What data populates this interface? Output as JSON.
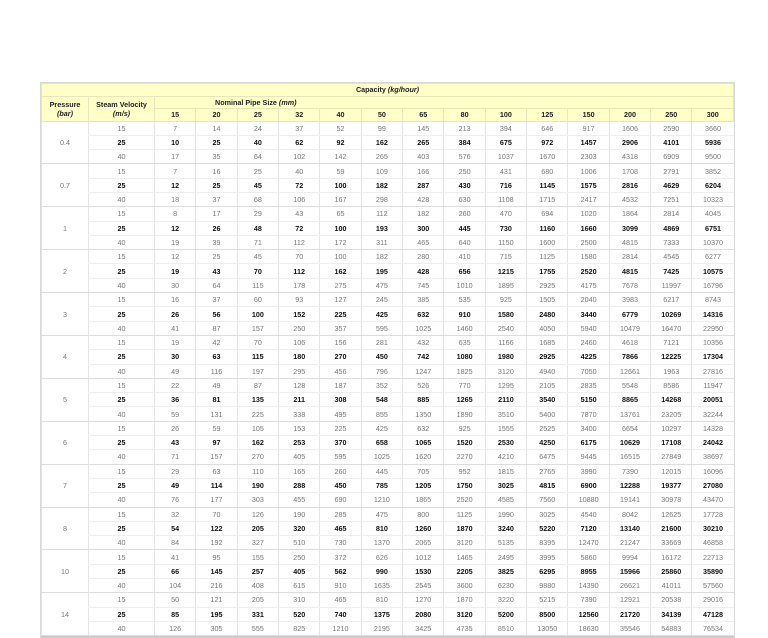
{
  "header": {
    "capacity": "Capacity",
    "capacity_unit": "(kg/hour)",
    "pressure": "Pressure",
    "pressure_unit": "(bar)",
    "velocity": "Steam Velocity",
    "velocity_unit": "(m/s)",
    "nominal": "Nominal Pipe Size",
    "nominal_unit": "(mm)"
  },
  "sizes": [
    "15",
    "20",
    "25",
    "32",
    "40",
    "50",
    "65",
    "80",
    "100",
    "125",
    "150",
    "200",
    "250",
    "300"
  ],
  "groups": [
    {
      "pressure": "0.4",
      "rows": [
        {
          "v": "15",
          "c": [
            "7",
            "14",
            "24",
            "37",
            "52",
            "99",
            "145",
            "213",
            "394",
            "646",
            "917",
            "1606",
            "2590",
            "3660"
          ]
        },
        {
          "v": "25",
          "c": [
            "10",
            "25",
            "40",
            "62",
            "92",
            "162",
            "265",
            "384",
            "675",
            "972",
            "1457",
            "2906",
            "4101",
            "5936"
          ]
        },
        {
          "v": "40",
          "c": [
            "17",
            "35",
            "64",
            "102",
            "142",
            "265",
            "403",
            "576",
            "1037",
            "1670",
            "2303",
            "4318",
            "6909",
            "9500"
          ]
        }
      ]
    },
    {
      "pressure": "0.7",
      "rows": [
        {
          "v": "15",
          "c": [
            "7",
            "16",
            "25",
            "40",
            "59",
            "109",
            "166",
            "250",
            "431",
            "680",
            "1006",
            "1708",
            "2791",
            "3852"
          ]
        },
        {
          "v": "25",
          "c": [
            "12",
            "25",
            "45",
            "72",
            "100",
            "182",
            "287",
            "430",
            "716",
            "1145",
            "1575",
            "2816",
            "4629",
            "6204"
          ]
        },
        {
          "v": "40",
          "c": [
            "18",
            "37",
            "68",
            "106",
            "167",
            "298",
            "428",
            "630",
            "1108",
            "1715",
            "2417",
            "4532",
            "7251",
            "10323"
          ]
        }
      ]
    },
    {
      "pressure": "1",
      "rows": [
        {
          "v": "15",
          "c": [
            "8",
            "17",
            "29",
            "43",
            "65",
            "112",
            "182",
            "260",
            "470",
            "694",
            "1020",
            "1864",
            "2814",
            "4045"
          ]
        },
        {
          "v": "25",
          "c": [
            "12",
            "26",
            "48",
            "72",
            "100",
            "193",
            "300",
            "445",
            "730",
            "1160",
            "1660",
            "3099",
            "4869",
            "6751"
          ]
        },
        {
          "v": "40",
          "c": [
            "19",
            "39",
            "71",
            "112",
            "172",
            "311",
            "465",
            "640",
            "1150",
            "1600",
            "2500",
            "4815",
            "7333",
            "10370"
          ]
        }
      ]
    },
    {
      "pressure": "2",
      "rows": [
        {
          "v": "15",
          "c": [
            "12",
            "25",
            "45",
            "70",
            "100",
            "182",
            "280",
            "410",
            "715",
            "1125",
            "1580",
            "2814",
            "4545",
            "6277"
          ]
        },
        {
          "v": "25",
          "c": [
            "19",
            "43",
            "70",
            "112",
            "162",
            "195",
            "428",
            "656",
            "1215",
            "1755",
            "2520",
            "4815",
            "7425",
            "10575"
          ]
        },
        {
          "v": "40",
          "c": [
            "30",
            "64",
            "115",
            "178",
            "275",
            "475",
            "745",
            "1010",
            "1895",
            "2925",
            "4175",
            "7678",
            "11997",
            "16796"
          ]
        }
      ]
    },
    {
      "pressure": "3",
      "rows": [
        {
          "v": "15",
          "c": [
            "16",
            "37",
            "60",
            "93",
            "127",
            "245",
            "385",
            "535",
            "925",
            "1505",
            "2040",
            "3983",
            "6217",
            "8743"
          ]
        },
        {
          "v": "25",
          "c": [
            "26",
            "56",
            "100",
            "152",
            "225",
            "425",
            "632",
            "910",
            "1580",
            "2480",
            "3440",
            "6779",
            "10269",
            "14316"
          ]
        },
        {
          "v": "40",
          "c": [
            "41",
            "87",
            "157",
            "250",
            "357",
            "595",
            "1025",
            "1460",
            "2540",
            "4050",
            "5940",
            "10479",
            "16470",
            "22950"
          ]
        }
      ]
    },
    {
      "pressure": "4",
      "rows": [
        {
          "v": "15",
          "c": [
            "19",
            "42",
            "70",
            "106",
            "156",
            "281",
            "432",
            "635",
            "1166",
            "1685",
            "2460",
            "4618",
            "7121",
            "10356"
          ]
        },
        {
          "v": "25",
          "c": [
            "30",
            "63",
            "115",
            "180",
            "270",
            "450",
            "742",
            "1080",
            "1980",
            "2925",
            "4225",
            "7866",
            "12225",
            "17304"
          ]
        },
        {
          "v": "40",
          "c": [
            "49",
            "116",
            "197",
            "295",
            "456",
            "796",
            "1247",
            "1825",
            "3120",
            "4940",
            "7050",
            "12661",
            "1963",
            "27816"
          ]
        }
      ]
    },
    {
      "pressure": "5",
      "rows": [
        {
          "v": "15",
          "c": [
            "22",
            "49",
            "87",
            "128",
            "187",
            "352",
            "526",
            "770",
            "1295",
            "2105",
            "2835",
            "5548",
            "8586",
            "11947"
          ]
        },
        {
          "v": "25",
          "c": [
            "36",
            "81",
            "135",
            "211",
            "308",
            "548",
            "885",
            "1265",
            "2110",
            "3540",
            "5150",
            "8865",
            "14268",
            "20051"
          ]
        },
        {
          "v": "40",
          "c": [
            "59",
            "131",
            "225",
            "338",
            "495",
            "855",
            "1350",
            "1890",
            "3510",
            "5400",
            "7870",
            "13761",
            "23205",
            "32244"
          ]
        }
      ]
    },
    {
      "pressure": "6",
      "rows": [
        {
          "v": "15",
          "c": [
            "26",
            "59",
            "105",
            "153",
            "225",
            "425",
            "632",
            "925",
            "1555",
            "2525",
            "3400",
            "6654",
            "10297",
            "14328"
          ]
        },
        {
          "v": "25",
          "c": [
            "43",
            "97",
            "162",
            "253",
            "370",
            "658",
            "1065",
            "1520",
            "2530",
            "4250",
            "6175",
            "10629",
            "17108",
            "24042"
          ]
        },
        {
          "v": "40",
          "c": [
            "71",
            "157",
            "270",
            "405",
            "595",
            "1025",
            "1620",
            "2270",
            "4210",
            "6475",
            "9445",
            "16515",
            "27849",
            "38697"
          ]
        }
      ]
    },
    {
      "pressure": "7",
      "rows": [
        {
          "v": "15",
          "c": [
            "29",
            "63",
            "110",
            "165",
            "260",
            "445",
            "705",
            "952",
            "1815",
            "2765",
            "3990",
            "7390",
            "12015",
            "16096"
          ]
        },
        {
          "v": "25",
          "c": [
            "49",
            "114",
            "190",
            "288",
            "450",
            "785",
            "1205",
            "1750",
            "3025",
            "4815",
            "6900",
            "12288",
            "19377",
            "27080"
          ]
        },
        {
          "v": "40",
          "c": [
            "76",
            "177",
            "303",
            "455",
            "690",
            "1210",
            "1865",
            "2520",
            "4585",
            "7560",
            "10880",
            "19141",
            "30978",
            "43470"
          ]
        }
      ]
    },
    {
      "pressure": "8",
      "rows": [
        {
          "v": "15",
          "c": [
            "32",
            "70",
            "126",
            "190",
            "285",
            "475",
            "800",
            "1125",
            "1990",
            "3025",
            "4540",
            "8042",
            "12625",
            "17728"
          ]
        },
        {
          "v": "25",
          "c": [
            "54",
            "122",
            "205",
            "320",
            "465",
            "810",
            "1260",
            "1870",
            "3240",
            "5220",
            "7120",
            "13140",
            "21600",
            "30210"
          ]
        },
        {
          "v": "40",
          "c": [
            "84",
            "192",
            "327",
            "510",
            "730",
            "1370",
            "2065",
            "3120",
            "5135",
            "8395",
            "12470",
            "21247",
            "33669",
            "46858"
          ]
        }
      ]
    },
    {
      "pressure": "10",
      "rows": [
        {
          "v": "15",
          "c": [
            "41",
            "95",
            "155",
            "250",
            "372",
            "626",
            "1012",
            "1465",
            "2495",
            "3995",
            "5860",
            "9994",
            "16172",
            "22713"
          ]
        },
        {
          "v": "25",
          "c": [
            "66",
            "145",
            "257",
            "405",
            "562",
            "990",
            "1530",
            "2205",
            "3825",
            "6295",
            "8955",
            "15966",
            "25860",
            "35890"
          ]
        },
        {
          "v": "40",
          "c": [
            "104",
            "216",
            "408",
            "615",
            "910",
            "1635",
            "2545",
            "3600",
            "6230",
            "9880",
            "14390",
            "26621",
            "41011",
            "57560"
          ]
        }
      ]
    },
    {
      "pressure": "14",
      "rows": [
        {
          "v": "15",
          "c": [
            "50",
            "121",
            "205",
            "310",
            "465",
            "810",
            "1270",
            "1870",
            "3220",
            "5215",
            "7390",
            "12921",
            "20538",
            "29016"
          ]
        },
        {
          "v": "25",
          "c": [
            "85",
            "195",
            "331",
            "520",
            "740",
            "1375",
            "2080",
            "3120",
            "5200",
            "8500",
            "12560",
            "21720",
            "34139",
            "47128"
          ]
        },
        {
          "v": "40",
          "c": [
            "126",
            "305",
            "555",
            "825",
            "1210",
            "2195",
            "3425",
            "4735",
            "8510",
            "13050",
            "18630",
            "35546",
            "54883",
            "76534"
          ]
        }
      ]
    }
  ]
}
